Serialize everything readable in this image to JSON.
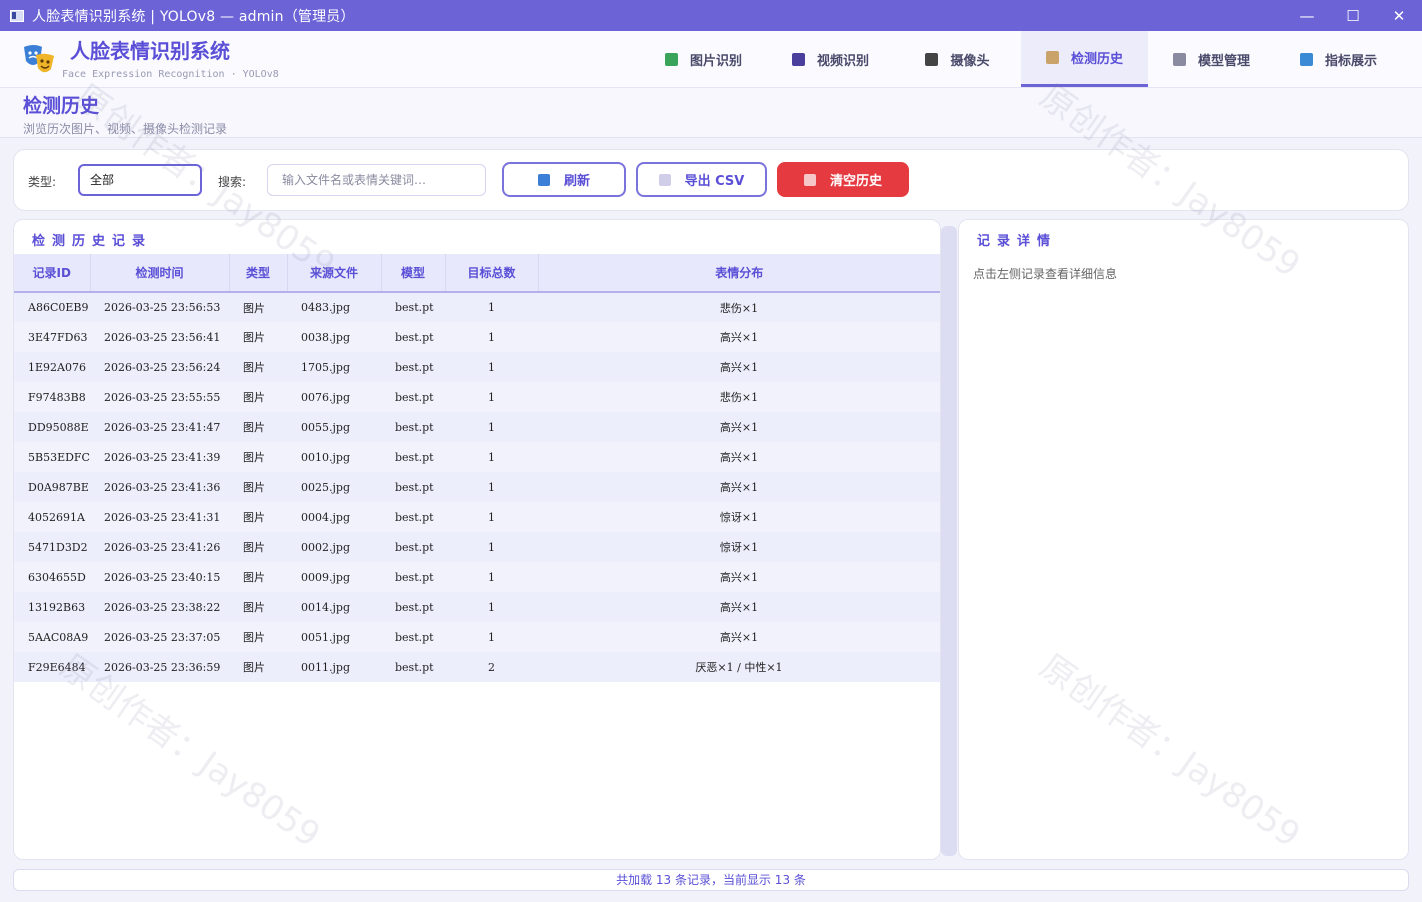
{
  "window": {
    "title": "人脸表情识别系统 | YOLOv8 — admin（管理员）",
    "minimize": "—",
    "maximize": "☐",
    "close": "✕"
  },
  "header": {
    "app_title": "人脸表情识别系统",
    "app_subtitle": "Face Expression Recognition  ·  YOLOv8",
    "nav": [
      {
        "label": "图片识别",
        "icon": "image-icon",
        "color": "#3aa55a"
      },
      {
        "label": "视频识别",
        "icon": "film-icon",
        "color": "#4b3f9e"
      },
      {
        "label": "摄像头",
        "icon": "camera-icon",
        "color": "#444444"
      },
      {
        "label": "检测历史",
        "icon": "history-icon",
        "color": "#c9a36a"
      },
      {
        "label": "模型管理",
        "icon": "gear-icon",
        "color": "#8a8aa0"
      },
      {
        "label": "指标展示",
        "icon": "bar-chart-icon",
        "color": "#3b8ad6"
      }
    ],
    "active_nav": "检测历史"
  },
  "page": {
    "title": "检测历史",
    "subtitle": "浏览历次图片、视频、摄像头检测记录"
  },
  "filters": {
    "type_label": "类型:",
    "type_value": "全部",
    "search_label": "搜索:",
    "search_placeholder": "输入文件名或表情关键词…",
    "refresh_label": "刷新",
    "export_label": "导出 CSV",
    "clear_label": "清空历史"
  },
  "history": {
    "title": "检测历史记录",
    "columns": [
      "记录ID",
      "检测时间",
      "类型",
      "来源文件",
      "模型",
      "目标总数",
      "表情分布"
    ],
    "rows": [
      {
        "id": "A86C0EB9",
        "time": "2026-03-25 23:56:53",
        "type": "图片",
        "file": "0483.jpg",
        "model": "best.pt",
        "count": "1",
        "dist": "悲伤×1"
      },
      {
        "id": "3E47FD63",
        "time": "2026-03-25 23:56:41",
        "type": "图片",
        "file": "0038.jpg",
        "model": "best.pt",
        "count": "1",
        "dist": "高兴×1"
      },
      {
        "id": "1E92A076",
        "time": "2026-03-25 23:56:24",
        "type": "图片",
        "file": "1705.jpg",
        "model": "best.pt",
        "count": "1",
        "dist": "高兴×1"
      },
      {
        "id": "F97483B8",
        "time": "2026-03-25 23:55:55",
        "type": "图片",
        "file": "0076.jpg",
        "model": "best.pt",
        "count": "1",
        "dist": "悲伤×1"
      },
      {
        "id": "DD95088E",
        "time": "2026-03-25 23:41:47",
        "type": "图片",
        "file": "0055.jpg",
        "model": "best.pt",
        "count": "1",
        "dist": "高兴×1"
      },
      {
        "id": "5B53EDFC",
        "time": "2026-03-25 23:41:39",
        "type": "图片",
        "file": "0010.jpg",
        "model": "best.pt",
        "count": "1",
        "dist": "高兴×1"
      },
      {
        "id": "D0A987BE",
        "time": "2026-03-25 23:41:36",
        "type": "图片",
        "file": "0025.jpg",
        "model": "best.pt",
        "count": "1",
        "dist": "高兴×1"
      },
      {
        "id": "4052691A",
        "time": "2026-03-25 23:41:31",
        "type": "图片",
        "file": "0004.jpg",
        "model": "best.pt",
        "count": "1",
        "dist": "惊讶×1"
      },
      {
        "id": "5471D3D2",
        "time": "2026-03-25 23:41:26",
        "type": "图片",
        "file": "0002.jpg",
        "model": "best.pt",
        "count": "1",
        "dist": "惊讶×1"
      },
      {
        "id": "6304655D",
        "time": "2026-03-25 23:40:15",
        "type": "图片",
        "file": "0009.jpg",
        "model": "best.pt",
        "count": "1",
        "dist": "高兴×1"
      },
      {
        "id": "13192B63",
        "time": "2026-03-25 23:38:22",
        "type": "图片",
        "file": "0014.jpg",
        "model": "best.pt",
        "count": "1",
        "dist": "高兴×1"
      },
      {
        "id": "5AAC08A9",
        "time": "2026-03-25 23:37:05",
        "type": "图片",
        "file": "0051.jpg",
        "model": "best.pt",
        "count": "1",
        "dist": "高兴×1"
      },
      {
        "id": "F29E6484",
        "time": "2026-03-25 23:36:59",
        "type": "图片",
        "file": "0011.jpg",
        "model": "best.pt",
        "count": "2",
        "dist": "厌恶×1 / 中性×1"
      }
    ]
  },
  "detail": {
    "title": "记录详情",
    "hint": "点击左侧记录查看详细信息"
  },
  "status": {
    "text": "共加载 13 条记录，当前显示 13 条"
  },
  "watermark": "原创作者：Jay8059",
  "colors": {
    "accent": "#6c63d6",
    "danger": "#e53b40"
  }
}
